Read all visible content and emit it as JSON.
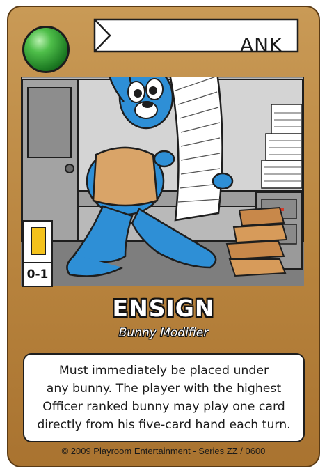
{
  "card": {
    "rank_label": "ANK",
    "stat_value": "0-1",
    "title": "ENSIGN",
    "subtitle": "Bunny Modifier",
    "body_lines": [
      "Must immediately be placed under",
      "any bunny.  The player with the highest",
      "Officer ranked bunny may play one card",
      "directly from his five-card hand each turn."
    ],
    "footer": "© 2009 Playroom Entertainment - Series ZZ / 0600"
  },
  "colors": {
    "frame": "#b8843e",
    "gem": "#4fbf4a",
    "stat_bar": "#f4c21c",
    "bunny": "#2e8fd6"
  },
  "icons": {
    "gem": "green-orb-icon",
    "stat": "carrot-bar-icon"
  }
}
